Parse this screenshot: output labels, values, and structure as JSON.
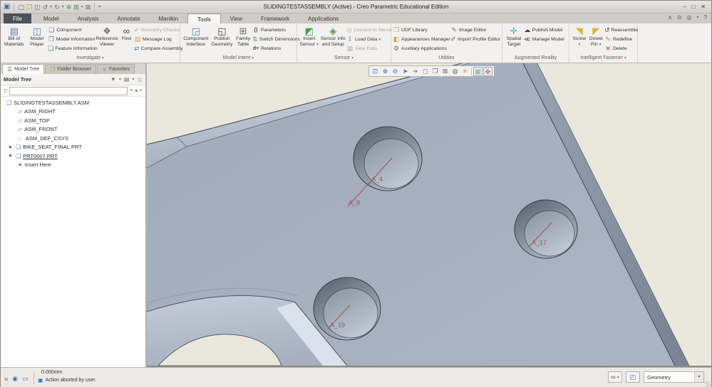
{
  "window": {
    "title": "SLIDINGTESTASSEMBLY (Active) - Creo Parametric Educational Edition"
  },
  "icons": {
    "app": "▣",
    "new": "▢",
    "open": "❒",
    "save": "◫",
    "undo": "↺",
    "redo": "↻",
    "regenerate": "✲",
    "windows": "⊞",
    "close_window": "⊠",
    "dropdown": "▾",
    "minimize": "–",
    "maximize": "□",
    "close": "✕",
    "collapse": "∧",
    "find_command": "⊙",
    "command_search": "◎",
    "help": "?",
    "bom": "▤",
    "model_player": "◫",
    "component": "❏",
    "model_information": "❐",
    "feature_information": "❑",
    "reference_viewer": "❖",
    "find": "∞",
    "geometry_checks": "✔",
    "message_log": "▤",
    "compare_assembly": "⇄",
    "component_interface": "◲",
    "publish_geometry": "◱",
    "family_table": "⊞",
    "parameters": "()",
    "switch_dimensions": "⇅",
    "relations": "d=",
    "insert_sensor": "◩",
    "sensor_info": "◈",
    "connect_to_server": "◎",
    "load_data": "⇩",
    "view_data": "▦",
    "udf_library": "❒",
    "appearances_manager": "◧",
    "auxiliary_applications": "⚙",
    "image_editor": "✎",
    "import_profile_editor": "✐",
    "spatial_target": "✛",
    "publish_model": "☁",
    "manage_model": "≪",
    "screw": "◥",
    "dowel_pin": "◤",
    "reassemble": "↺",
    "redefine": "✎",
    "delete": "✕",
    "model_tree_tab": "☰",
    "folder_tab": "❒",
    "favorites_tab": "★",
    "tree_filter": "▼",
    "tree_list": "▤",
    "tree_cols": "▥",
    "funnel": "▽",
    "clear": "×",
    "add": "+",
    "assembly": "❑",
    "plane": "▱",
    "csys": "∟",
    "part": "❑",
    "insert_here": "➤",
    "expander": "▶",
    "sb_tree": "≡",
    "sb_browser": "◉",
    "sb_panel": "▭",
    "sb_message": "▣",
    "sb_find": "∞",
    "sb_box": "◰"
  },
  "tabs": {
    "items": [
      "File",
      "Model",
      "Analysis",
      "Annotate",
      "Manikin",
      "Tools",
      "View",
      "Framework",
      "Applications"
    ],
    "active": "Tools"
  },
  "ribbon": {
    "investigate": {
      "label": "Investigate",
      "bill_of_materials": "Bill of Materials",
      "model_player": "Model Player",
      "component": "Component",
      "model_information": "Model Information",
      "feature_information": "Feature Information",
      "reference_viewer": "Reference Viewer",
      "find": "Find",
      "geometry_checks": "Geometry Checks",
      "message_log": "Message Log",
      "compare_assembly": "Compare Assembly"
    },
    "model_intent": {
      "label": "Model Intent",
      "component_interface": "Component Interface",
      "publish_geometry": "Publish Geometry",
      "family_table": "Family Table",
      "parameters": "Parameters",
      "switch_dimensions": "Switch Dimensions",
      "relations": "Relations"
    },
    "sensor": {
      "label": "Sensor",
      "insert_sensor": "Insert Sensor",
      "sensor_info": "Sensor Info and Setup",
      "connect_to_server": "Connect to Server",
      "load_data": "Load Data",
      "view_data": "View Data"
    },
    "utilities": {
      "label": "Utilities",
      "udf_library": "UDF Library",
      "appearances_manager": "Appearances Manager",
      "auxiliary_applications": "Auxiliary Applications",
      "image_editor": "Image Editor",
      "import_profile_editor": "Import Profile Editor"
    },
    "augmented_reality": {
      "label": "Augmented Reality",
      "spatial_target": "Spatial Target",
      "publish_model": "Publish Model",
      "manage_model": "Manage Model"
    },
    "intelligent_fastener": {
      "label": "Intelligent Fastener",
      "screw": "Screw",
      "dowel_pin": "Dowel Pin",
      "reassemble": "Reassemble",
      "redefine": "Redefine",
      "delete": "Delete"
    }
  },
  "left_panel": {
    "tabs": [
      {
        "label": "Model Tree"
      },
      {
        "label": "Folder Browser"
      },
      {
        "label": "Favorites"
      }
    ],
    "header": "Model Tree",
    "tree": {
      "items": [
        {
          "label": "SLIDINGTESTASSEMBLY.ASM"
        },
        {
          "label": "ASM_RIGHT"
        },
        {
          "label": "ASM_TOP"
        },
        {
          "label": "ASM_FRONT"
        },
        {
          "label": "ASM_DEF_CSYS"
        },
        {
          "label": "BIKE_SEAT_FINAL.PRT"
        },
        {
          "label": "PRT0007.PRT"
        },
        {
          "label": "Insert Here"
        }
      ]
    }
  },
  "viewport": {
    "axes": {
      "a4": "A_4",
      "a8": "A_8",
      "a17": "A_17",
      "a19": "A_19"
    },
    "colors": {
      "background": "#eae8dc",
      "plate": "#a7b0be",
      "axis": "#9b5454",
      "edge": "#4a5462"
    }
  },
  "status_bar": {
    "dimension": "0.000mm",
    "message": "Action aborted by user.",
    "filter_value": "Geometry"
  }
}
